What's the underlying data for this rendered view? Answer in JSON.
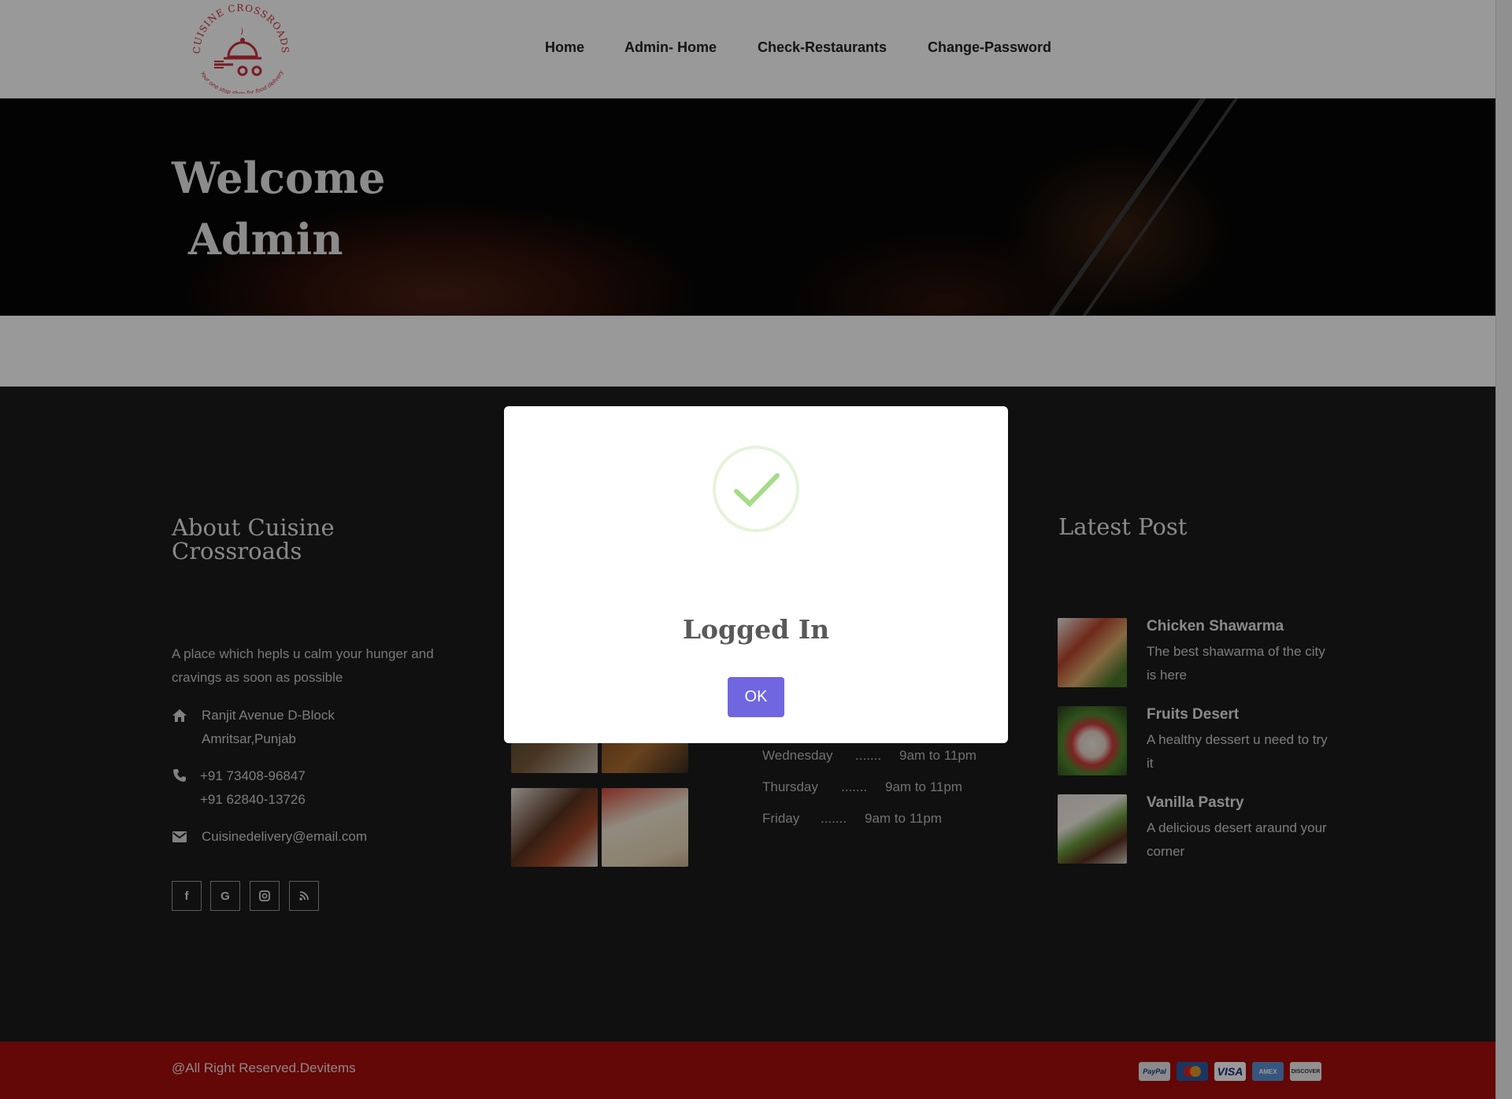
{
  "header": {
    "logo_name": "Cuisine Crossroads",
    "logo_tagline": "Your one stop shop for food delivery",
    "nav": [
      "Home",
      "Admin- Home",
      "Check-Restaurants",
      "Change-Password"
    ]
  },
  "hero": {
    "title_line1": "Welcome",
    "title_line2": "Admin"
  },
  "footer": {
    "about_title_line1": "About Cuisine",
    "about_title_line2": "Crossroads",
    "about_text": "A place which hepls u calm your hunger and cravings as soon as possible",
    "address_line1": "Ranjit Avenue D-Block",
    "address_line2": "Amritsar,Punjab",
    "phone1": "+91 73408-96847",
    "phone2": "+91 62840-13726",
    "email": "Cuisinedelivery@email.com",
    "social_icons": [
      "facebook-icon",
      "google-icon",
      "instagram-icon",
      "rss-icon"
    ],
    "hours": [
      {
        "day": "Wednesday",
        "dots": ".......",
        "time": "9am to 11pm"
      },
      {
        "day": "Thursday",
        "dots": ".......",
        "time": "9am to 11pm"
      },
      {
        "day": "Friday",
        "dots": ".......",
        "time": "9am to 11pm"
      }
    ],
    "latest_title": "Latest Post",
    "posts": [
      {
        "title": "Chicken Shawarma",
        "desc": "The best shawarma of the city is here"
      },
      {
        "title": "Fruits Desert",
        "desc": "A healthy dessert u need to try it"
      },
      {
        "title": "Vanilla Pastry",
        "desc": "A delicious desert araund your corner"
      }
    ],
    "copyright": "@All Right Reserved.Devitems",
    "payment_methods": [
      "PayPal",
      "MasterCard",
      "VISA",
      "AMEX",
      "DISCOVER"
    ]
  },
  "modal": {
    "icon": "success-check-icon",
    "title": "Logged In",
    "ok_label": "OK"
  },
  "colors": {
    "brand_red": "#a50c0c",
    "modal_button": "#7066e0",
    "success_green": "#a5dc86"
  }
}
